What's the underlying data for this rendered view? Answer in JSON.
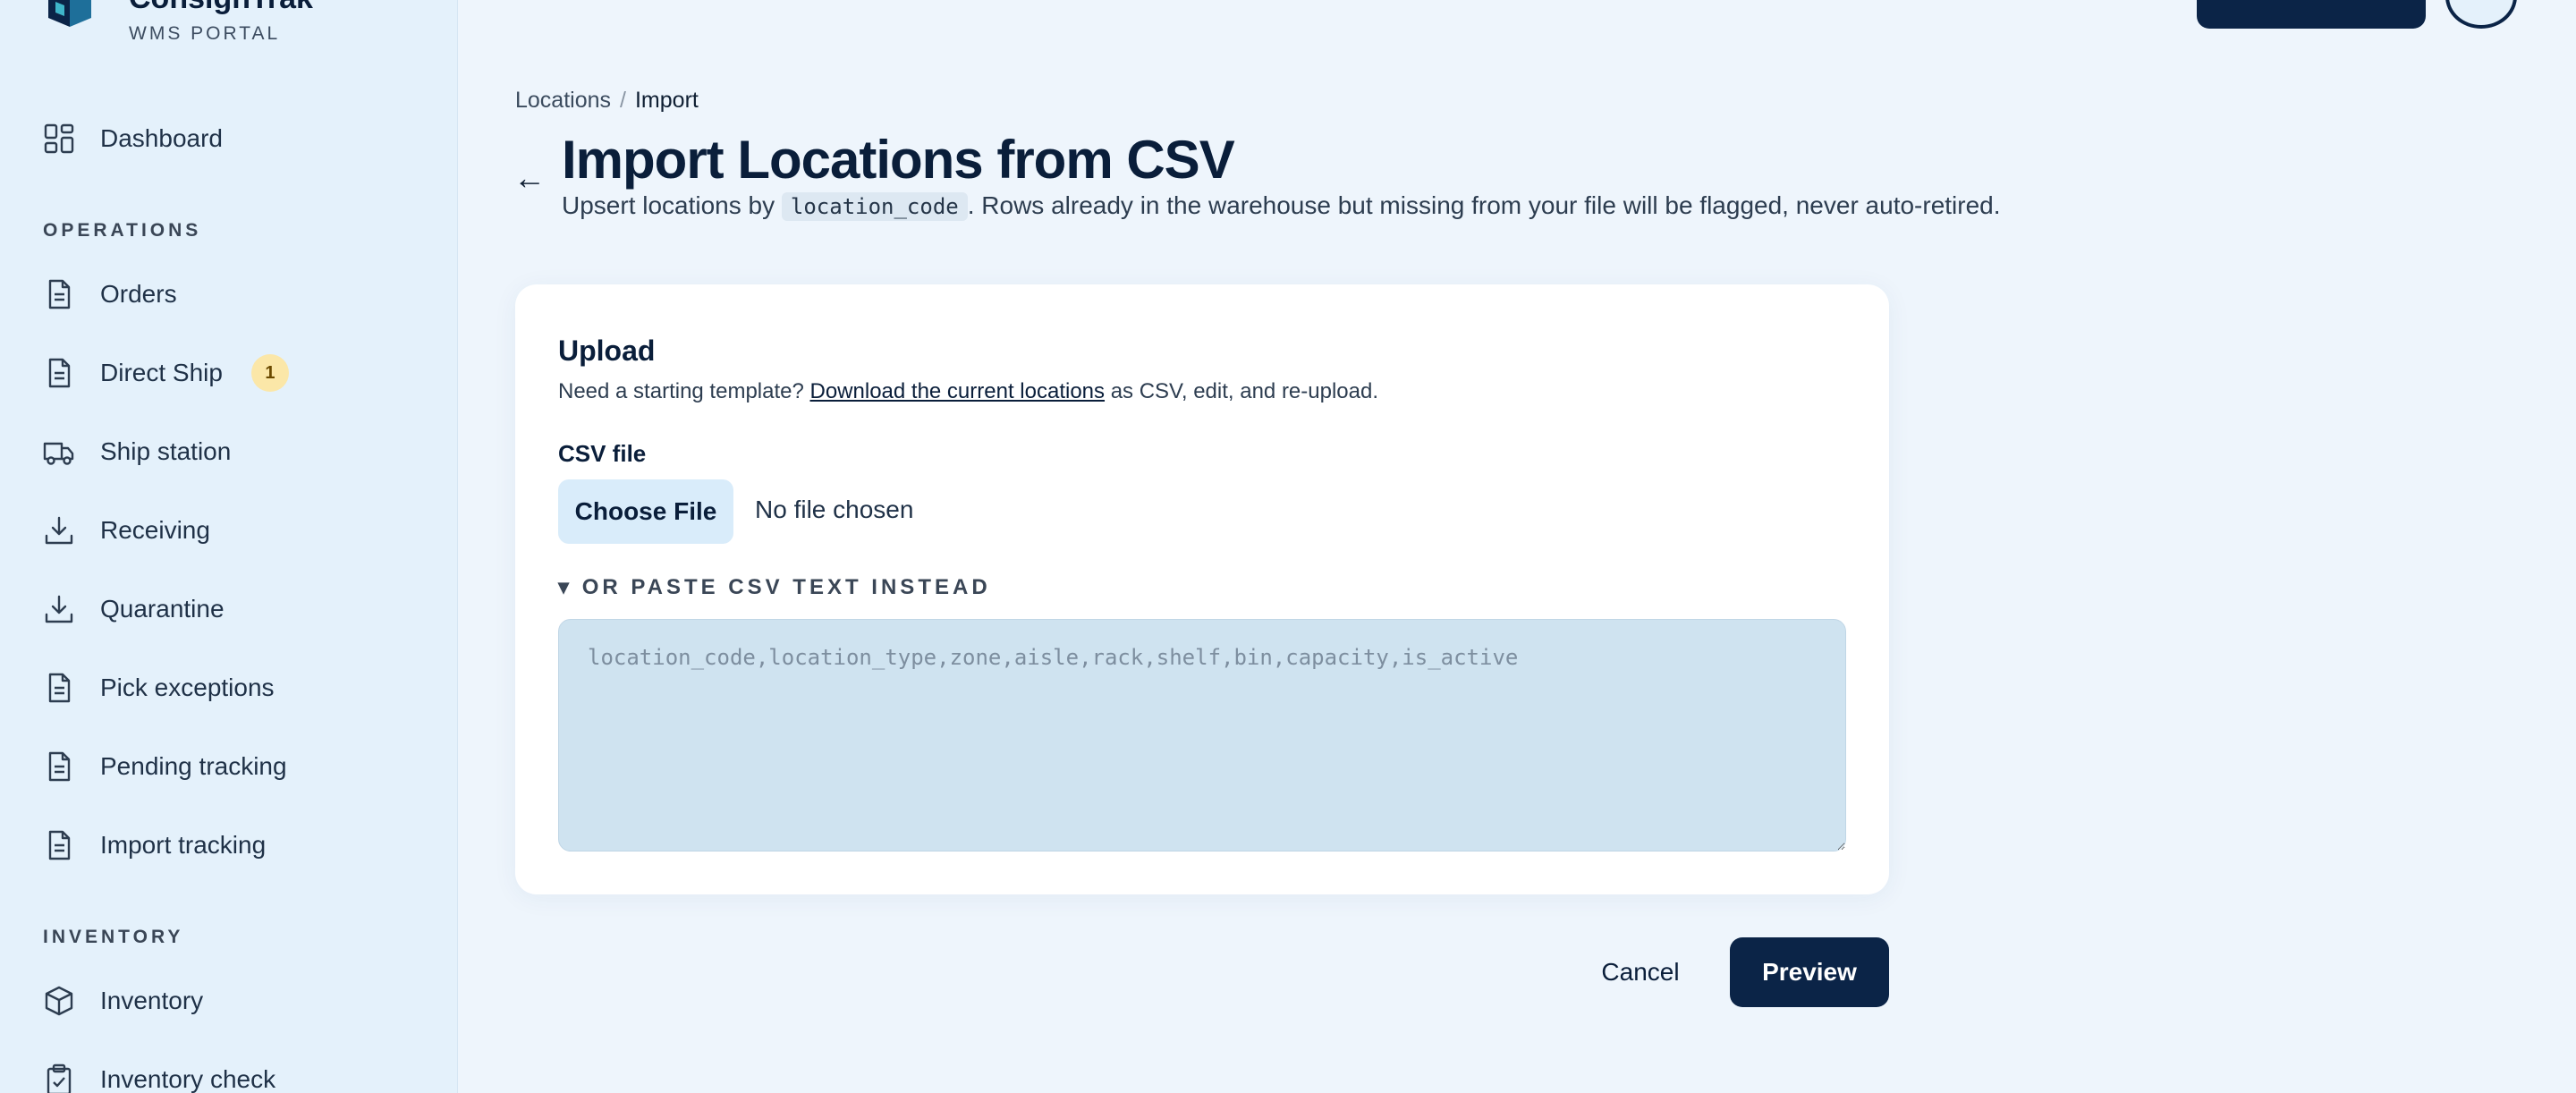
{
  "brand": {
    "name": "ConsignTrak",
    "subtitle": "WMS PORTAL"
  },
  "sidebar": {
    "top_items": [
      {
        "label": "Dashboard",
        "icon": "dashboard-icon"
      }
    ],
    "sections": [
      {
        "heading": "OPERATIONS",
        "items": [
          {
            "label": "Orders",
            "icon": "document-icon"
          },
          {
            "label": "Direct Ship",
            "icon": "document-icon",
            "badge": "1"
          },
          {
            "label": "Ship station",
            "icon": "truck-icon"
          },
          {
            "label": "Receiving",
            "icon": "download-icon"
          },
          {
            "label": "Quarantine",
            "icon": "download-icon"
          },
          {
            "label": "Pick exceptions",
            "icon": "document-icon"
          },
          {
            "label": "Pending tracking",
            "icon": "document-icon"
          },
          {
            "label": "Import tracking",
            "icon": "document-icon"
          }
        ]
      },
      {
        "heading": "INVENTORY",
        "items": [
          {
            "label": "Inventory",
            "icon": "box-icon"
          },
          {
            "label": "Inventory check",
            "icon": "clipboard-check-icon"
          }
        ]
      }
    ]
  },
  "breadcrumb": {
    "parent": "Locations",
    "separator": "/",
    "current": "Import"
  },
  "page": {
    "title": "Import Locations from CSV",
    "subtitle_before": "Upsert locations by ",
    "subtitle_code": "location_code",
    "subtitle_after": ". Rows already in the warehouse but missing from your file will be flagged, never auto-retired."
  },
  "upload": {
    "title": "Upload",
    "help_before": "Need a starting template? ",
    "help_link": "Download the current locations",
    "help_after": " as CSV, edit, and re-upload.",
    "file_label": "CSV file",
    "choose_button": "Choose File",
    "file_status": "No file chosen",
    "paste_toggle": "▾ OR PASTE CSV TEXT INSTEAD",
    "textarea_placeholder": "location_code,location_type,zone,aisle,rack,shelf,bin,capacity,is_active",
    "textarea_value": ""
  },
  "actions": {
    "cancel": "Cancel",
    "preview": "Preview"
  },
  "colors": {
    "primary": "#0b2447",
    "sidebar_bg": "#e4f1fb",
    "page_bg": "#eef5fc",
    "badge_bg": "#fbe7a8"
  }
}
